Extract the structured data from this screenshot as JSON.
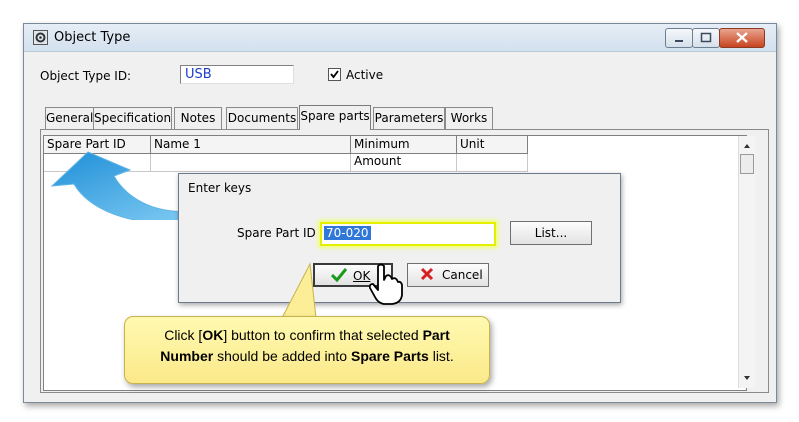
{
  "window": {
    "title": "Object Type"
  },
  "header": {
    "id_label": "Object Type ID:",
    "id_value": "USB",
    "active_label": "Active",
    "active_checked": true
  },
  "tabs": [
    "General",
    "Specification",
    "Notes",
    "Documents",
    "Spare parts",
    "Parameters",
    "Works"
  ],
  "active_tab": "Spare parts",
  "grid": {
    "columns": [
      "Spare Part ID",
      "Name 1",
      "Minimum Amount",
      "Unit"
    ]
  },
  "dialog": {
    "title": "Enter keys",
    "field_label": "Spare Part ID",
    "field_value": "70-020",
    "list_button": "List...",
    "ok_button": "OK",
    "cancel_button": "Cancel"
  },
  "callout": {
    "t1": "Click [",
    "t2": "OK",
    "t3": "] button to confirm that selected ",
    "t4": "Part Number",
    "t5": " should be added into ",
    "t6": "Spare Parts",
    "t7": " list."
  },
  "colors": {
    "callout_bg": "#fbe98a",
    "arrow": "#3aa6e4",
    "input_glow": "#e5ef00"
  }
}
